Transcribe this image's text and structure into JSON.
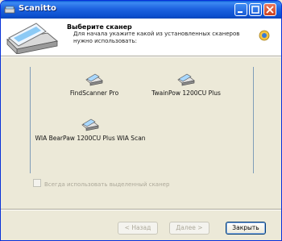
{
  "window": {
    "title": "Scanitto"
  },
  "header": {
    "title": "Выберите сканер",
    "subtitle": "Для начала укажите какой из установленных сканеров нужно использовать:"
  },
  "scanners": [
    {
      "label": "FindScanner Pro"
    },
    {
      "label": "TwainPow 1200CU Plus"
    },
    {
      "label": "WIA BearPaw 1200CU Plus WIA Scan"
    }
  ],
  "checkbox": {
    "label": "Всегда использовать выделенный сканер",
    "checked": false
  },
  "buttons": {
    "back": "< Назад",
    "next": "Далее >",
    "close": "Закрыть"
  },
  "icons": {
    "app": "scanner-app-icon",
    "header_art": "flatbed-scanner-icon",
    "help": "help-icon",
    "scanner": "scanner-icon"
  }
}
